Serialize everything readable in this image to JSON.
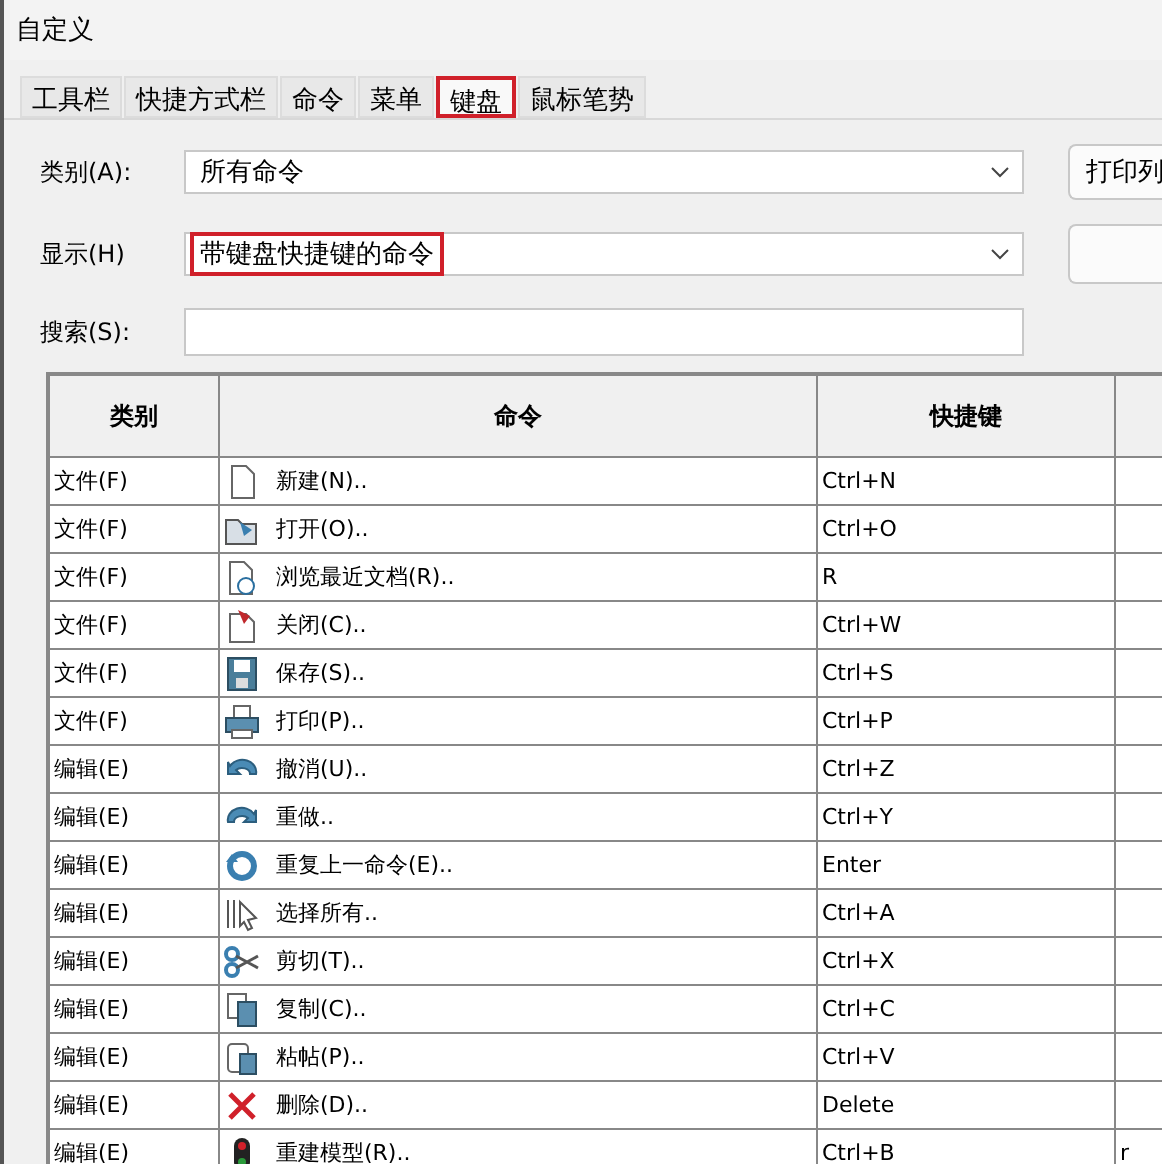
{
  "window": {
    "title": "自定义"
  },
  "tabs": [
    {
      "label": "工具栏",
      "selected": false,
      "highlighted": false
    },
    {
      "label": "快捷方式栏",
      "selected": false,
      "highlighted": false
    },
    {
      "label": "命令",
      "selected": false,
      "highlighted": false
    },
    {
      "label": "菜单",
      "selected": false,
      "highlighted": false
    },
    {
      "label": "键盘",
      "selected": true,
      "highlighted": true
    },
    {
      "label": "鼠标笔势",
      "selected": false,
      "highlighted": false
    }
  ],
  "category": {
    "label": "类别(A):",
    "value": "所有命令",
    "highlighted": false
  },
  "display": {
    "label": "显示(H)",
    "value": "带键盘快捷键的命令",
    "highlighted": true
  },
  "search": {
    "label": "搜索(S):"
  },
  "buttons": [
    "打印列"
  ],
  "table": {
    "columns": [
      "类别",
      "命令",
      "快捷键"
    ],
    "rows": [
      {
        "category": "文件(F)",
        "command": "新建(N)..",
        "shortcut": "Ctrl+N"
      },
      {
        "category": "文件(F)",
        "command": "打开(O)..",
        "shortcut": "Ctrl+O"
      },
      {
        "category": "文件(F)",
        "command": "浏览最近文档(R)..",
        "shortcut": "R"
      },
      {
        "category": "文件(F)",
        "command": "关闭(C)..",
        "shortcut": "Ctrl+W"
      },
      {
        "category": "文件(F)",
        "command": "保存(S)..",
        "shortcut": "Ctrl+S"
      },
      {
        "category": "文件(F)",
        "command": "打印(P)..",
        "shortcut": "Ctrl+P"
      },
      {
        "category": "编辑(E)",
        "command": "撤消(U)..",
        "shortcut": "Ctrl+Z"
      },
      {
        "category": "编辑(E)",
        "command": "重做..",
        "shortcut": "Ctrl+Y"
      },
      {
        "category": "编辑(E)",
        "command": "重复上一命令(E)..",
        "shortcut": "Enter"
      },
      {
        "category": "编辑(E)",
        "command": "选择所有..",
        "shortcut": "Ctrl+A"
      },
      {
        "category": "编辑(E)",
        "command": "剪切(T)..",
        "shortcut": "Ctrl+X"
      },
      {
        "category": "编辑(E)",
        "command": "复制(C)..",
        "shortcut": "Ctrl+C"
      },
      {
        "category": "编辑(E)",
        "command": "粘帖(P)..",
        "shortcut": "Ctrl+V"
      },
      {
        "category": "编辑(E)",
        "command": "删除(D)..",
        "shortcut": "Delete"
      },
      {
        "category": "编辑(E)",
        "command": "重建模型(R)..",
        "shortcut": "Ctrl+B",
        "column_4": "r"
      }
    ]
  }
}
